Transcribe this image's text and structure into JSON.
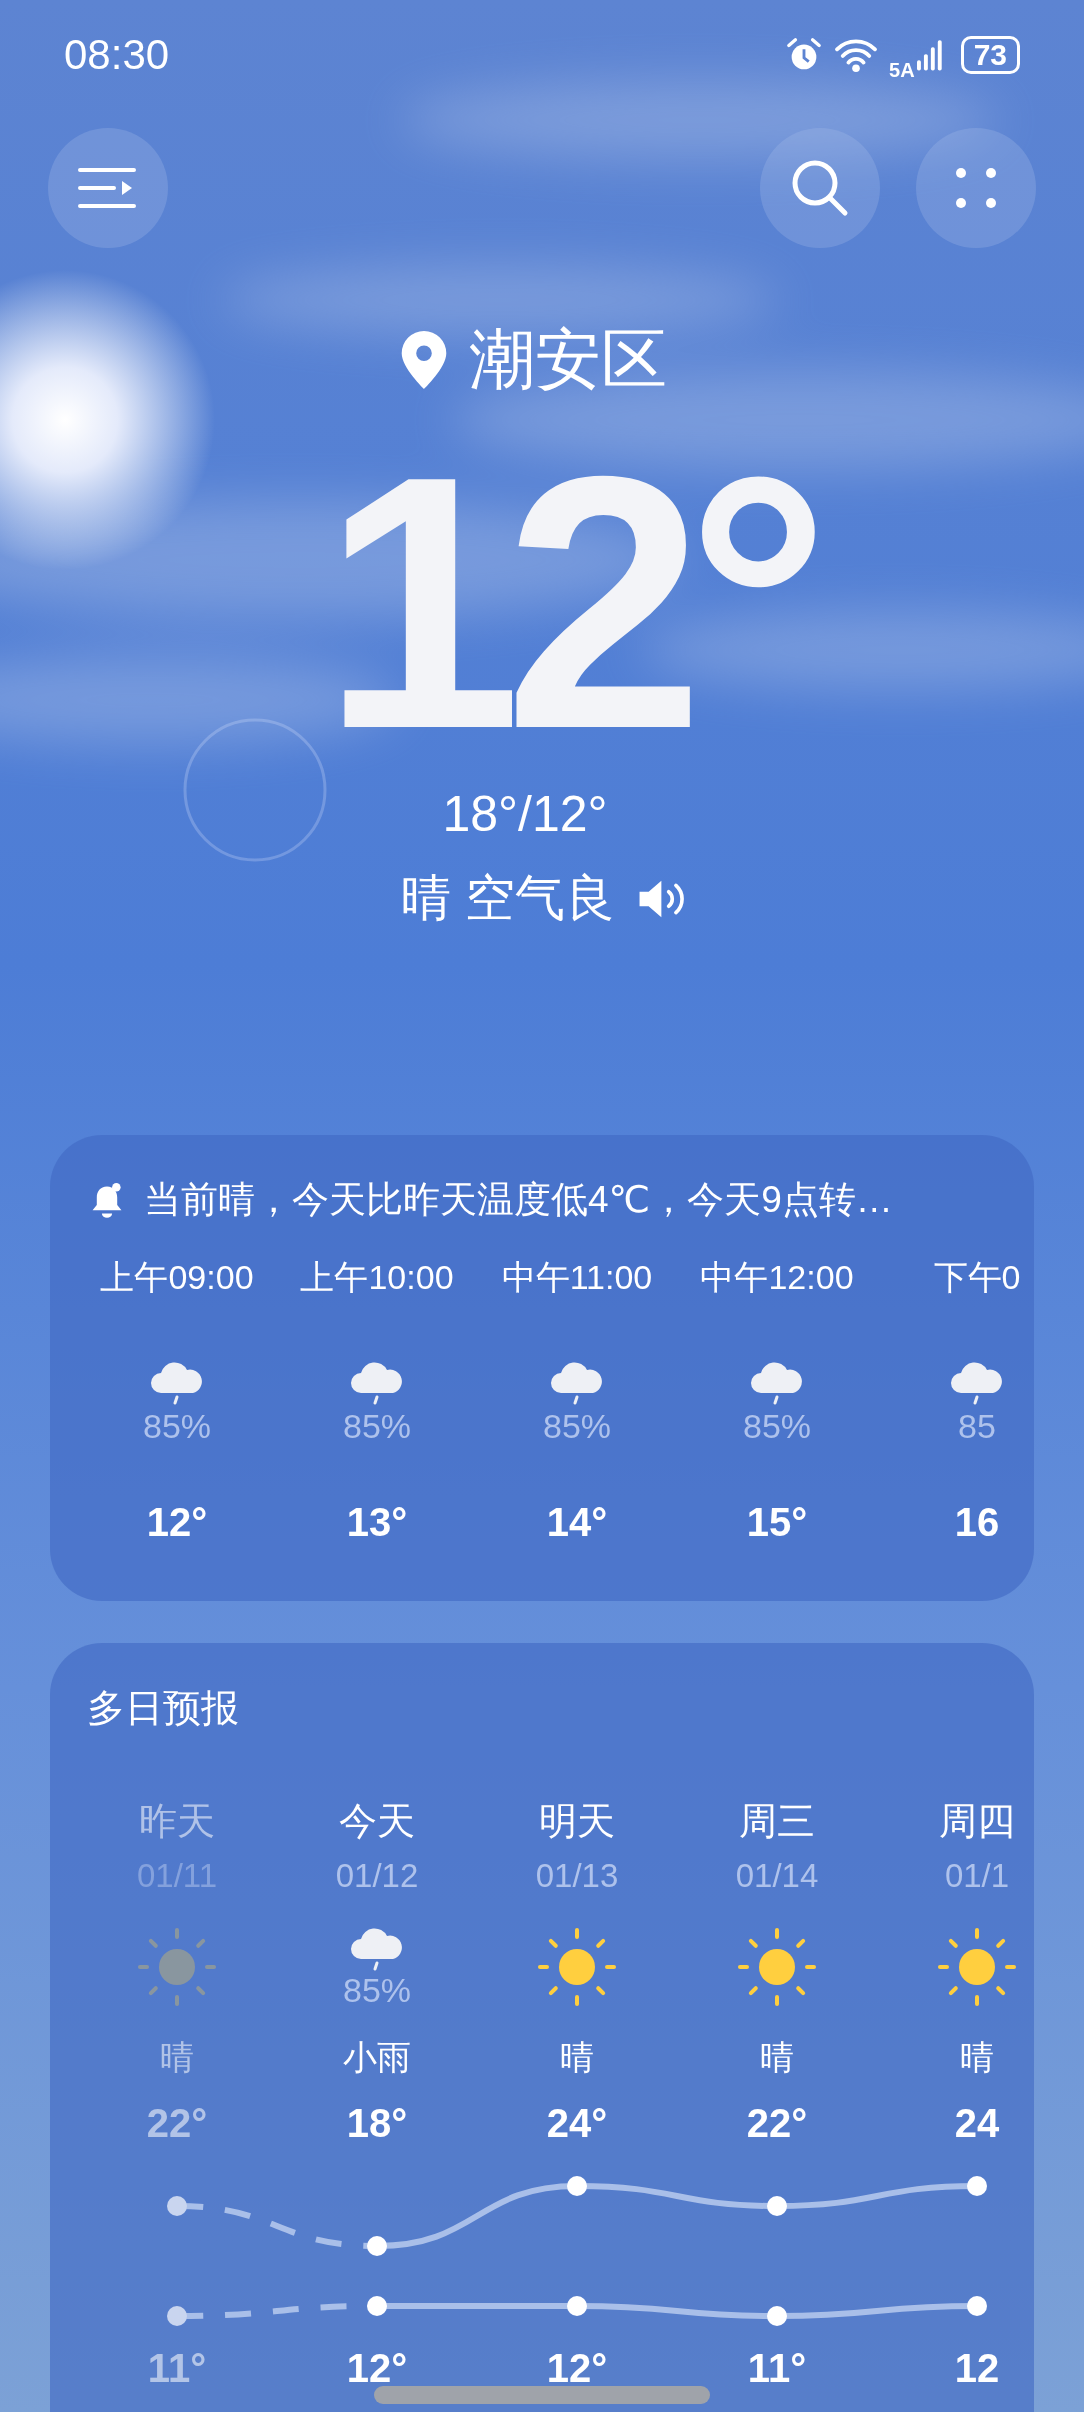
{
  "status_bar": {
    "time": "08:30",
    "network": "5A",
    "battery": "73"
  },
  "location": "潮安区",
  "current": {
    "temperature": "12°",
    "range": "18°/12°",
    "summary": "晴 空气良"
  },
  "hourly": {
    "alert": "当前晴，今天比昨天温度低4℃，今天9点转…",
    "hours": [
      {
        "time": "上午09:00",
        "kind": "rain",
        "precip": "85%",
        "temp": "12°"
      },
      {
        "time": "上午10:00",
        "kind": "rain",
        "precip": "85%",
        "temp": "13°"
      },
      {
        "time": "中午11:00",
        "kind": "rain",
        "precip": "85%",
        "temp": "14°"
      },
      {
        "time": "中午12:00",
        "kind": "rain",
        "precip": "85%",
        "temp": "15°"
      },
      {
        "time": "下午0",
        "kind": "rain",
        "precip": "85",
        "temp": "16"
      }
    ]
  },
  "daily": {
    "title": "多日预报",
    "days": [
      {
        "day": "昨天",
        "date": "01/11",
        "kind": "sun",
        "condition": "晴",
        "high": "22°",
        "low": "11°",
        "past": true
      },
      {
        "day": "今天",
        "date": "01/12",
        "kind": "rain",
        "precip": "85%",
        "condition": "小雨",
        "high": "18°",
        "low": "12°",
        "past": false
      },
      {
        "day": "明天",
        "date": "01/13",
        "kind": "sun",
        "condition": "晴",
        "high": "24°",
        "low": "12°",
        "past": false
      },
      {
        "day": "周三",
        "date": "01/14",
        "kind": "sun",
        "condition": "晴",
        "high": "22°",
        "low": "11°",
        "past": false
      },
      {
        "day": "周四",
        "date": "01/1",
        "kind": "sun",
        "condition": "晴",
        "high": "24",
        "low": "12",
        "past": false
      }
    ]
  }
}
